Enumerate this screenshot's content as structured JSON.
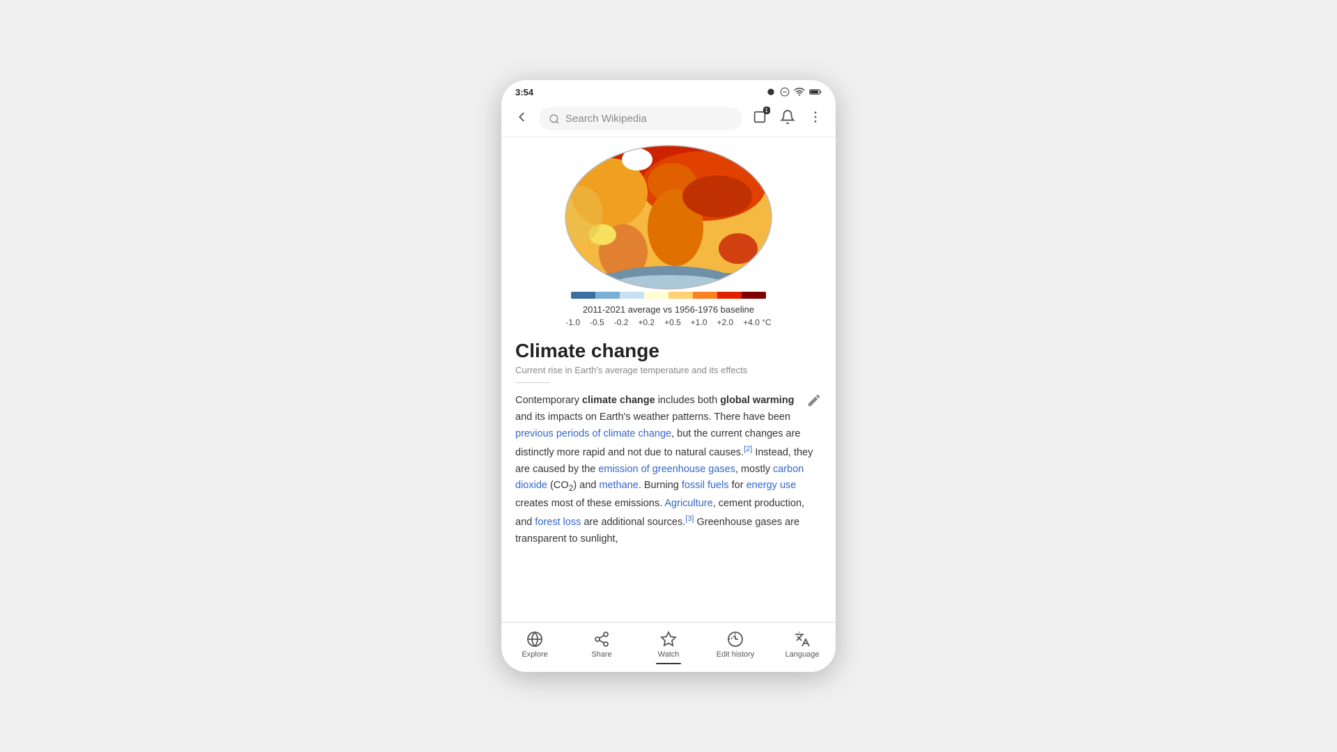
{
  "statusBar": {
    "time": "3:54",
    "icons": [
      "record",
      "minus-circle",
      "wifi",
      "battery"
    ]
  },
  "topBar": {
    "searchPlaceholder": "Search Wikipedia",
    "tabCount": "1"
  },
  "mapSection": {
    "caption": "2011-2021 average vs 1956-1976 baseline",
    "scaleLabels": [
      "-1.0",
      "-0.5",
      "-0.2",
      "+0.2",
      "+0.5",
      "+1.0",
      "+2.0",
      "+4.0 °C"
    ],
    "colorStops": [
      "#9bb8d4",
      "#b8d0e8",
      "#d0e4f4",
      "#ffffd0",
      "#ffe090",
      "#ffa040",
      "#e05000",
      "#a00000"
    ]
  },
  "article": {
    "title": "Climate change",
    "subtitle": "Current rise in Earth's average temperature and its effects",
    "intro": "Contemporary ",
    "bold1": "climate change",
    "text1": " includes both ",
    "bold2": "global warming",
    "text2": " and its impacts on Earth's weather patterns. There have been ",
    "link1": "previous periods of climate change",
    "text3": ", but the current changes are distinctly more rapid and not due to natural causes.",
    "ref2": "[2]",
    "text4": " Instead, they are caused by the ",
    "link2": "emission of greenhouse gases",
    "text5": ", mostly ",
    "link3": "carbon dioxide",
    "text6": " (CO",
    "sub": "2",
    "text7": ") and ",
    "link4": "methane",
    "text8": ". Burning ",
    "link5": "fossil fuels",
    "text9": " for ",
    "link6": "energy use",
    "text10": " creates most of these emissions. ",
    "link7": "Agriculture",
    "text11": ", cement production, and ",
    "link8": "forest loss",
    "text12": " are additional sources.",
    "ref3": "[3]",
    "text13": " Greenhouse gases are transparent to sunlight,"
  },
  "bottomNav": {
    "items": [
      {
        "label": "Explore",
        "icon": "globe"
      },
      {
        "label": "Share",
        "icon": "share"
      },
      {
        "label": "Watch",
        "icon": "star",
        "active": true
      },
      {
        "label": "Edit history",
        "icon": "edit"
      },
      {
        "label": "Language",
        "icon": "translate"
      }
    ]
  }
}
